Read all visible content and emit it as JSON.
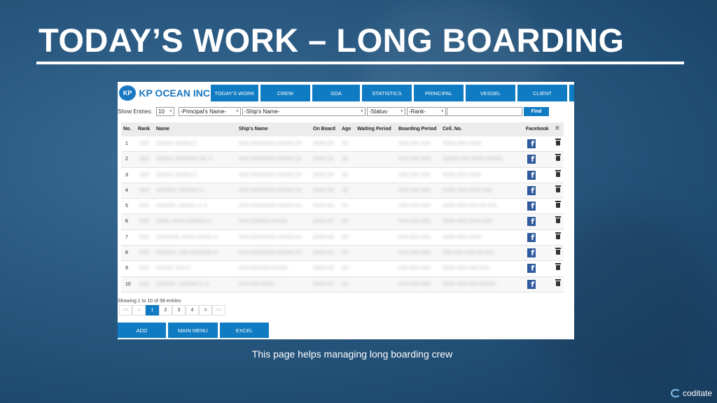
{
  "slide": {
    "title": "TODAY’S WORK – LONG BOARDING",
    "caption": "This page helps managing long boarding crew",
    "brand": "coditate"
  },
  "app": {
    "logo_badge": "KP",
    "logo_text": "KP OCEAN INC",
    "nav": [
      "TODAY'S WORK",
      "CREW",
      "SOA",
      "STATISTICS",
      "PRINCIPAL",
      "VESSEL",
      "CLIENT"
    ]
  },
  "filters": {
    "show_label": "Show Entries:",
    "show_value": "10",
    "principal": "-Principal's Name-",
    "ship": "-Ship's Name-",
    "status": "-Status-",
    "rank": "-Rank-",
    "search_value": "",
    "find_label": "Find"
  },
  "table": {
    "columns": [
      "No.",
      "Rank",
      "Name",
      "Ship's Name",
      "On Board",
      "Age",
      "Waiting Period",
      "Boarding Period",
      "Cell. No.",
      "Facebook"
    ],
    "facebook_glyph": "f",
    "rows": [
      {
        "no": "1",
        "rank": "XXX",
        "name": "XXXXX, XXXXX X.",
        "ship": "XXX XXXXXXXX XXXXX XX",
        "onboard": "XXXX.XX",
        "age": "XX",
        "boarding": "XXX XXX XXX",
        "cell": "XXXX XXX XXXX"
      },
      {
        "no": "2",
        "rank": "XXX",
        "name": "XXXXX, XXXXXXX XX. X.",
        "ship": "XXX XXXXXXXX XXXXX XX",
        "onboard": "XXXX.XX",
        "age": "XX",
        "boarding": "XXX XXX XXX",
        "cell": "XXXXX XXX XXXX XXXXX"
      },
      {
        "no": "3",
        "rank": "XXX",
        "name": "XXXXX, XXXXX X.",
        "ship": "XXX XXXXXXXX XXXXX XX",
        "onboard": "XXXX.XX",
        "age": "XX",
        "boarding": "XXX XXX XXX",
        "cell": "XXXX XXX XXXX"
      },
      {
        "no": "4",
        "rank": "XXX",
        "name": "XXXXXX, XXXXXX X.",
        "ship": "XXX XXXXXXXX XXXXX XX",
        "onboard": "XXXX.XX",
        "age": "XX",
        "boarding": "XXX XXX XXX",
        "cell": "XXXX XXX XXXX XXX"
      },
      {
        "no": "5",
        "rank": "XXX",
        "name": "XXXXXX, XXXXX, X. X.",
        "ship": "XXX XXXXXXXX XXXXX XX",
        "onboard": "XXXX.XX",
        "age": "XX",
        "boarding": "XXX XXX XXX",
        "cell": "XXXX XXX XXX XX XXX"
      },
      {
        "no": "6",
        "rank": "XXX",
        "name": "XXXX, XXXX XXXXXX X.",
        "ship": "XXX XXXXXX XXXXX",
        "onboard": "XXXX.XX",
        "age": "XX",
        "boarding": "XXX XXX XXX",
        "cell": "XXXX XXX XXXX XXX"
      },
      {
        "no": "7",
        "rank": "XXX",
        "name": "XXXXXXX, XXXX XXXXX X.",
        "ship": "XXX XXXXXXXX XXXXX XX",
        "onboard": "XXXX.XX",
        "age": "XX",
        "boarding": "XXX XXX XXX",
        "cell": "XXXX XXX XXXX"
      },
      {
        "no": "8",
        "rank": "XXX",
        "name": "XXXXXX, XXX XXXXXXX X.",
        "ship": "XXX XXXXXXXX XXXXX XX",
        "onboard": "XXXX.XX",
        "age": "XX",
        "boarding": "XXX XXX XXX",
        "cell": "XXX XXX XXX XX XXX"
      },
      {
        "no": "9",
        "rank": "XXX",
        "name": "XXXXX, XXX X.",
        "ship": "XXX XXXXXX XXXXX",
        "onboard": "XXXX.XX",
        "age": "XX",
        "boarding": "XXX XXX XXX",
        "cell": "XXXX XXX XXX XXX"
      },
      {
        "no": "10",
        "rank": "XXX",
        "name": "XXXXXX, XXXXXX X. X.",
        "ship": "XXX XXX XXXX",
        "onboard": "XXXX.XX",
        "age": "XX",
        "boarding": "XXX XXX XXX",
        "cell": "XXXX XXX XXX XXXXX"
      }
    ]
  },
  "footer": {
    "showing": "Showing 1 to 10 of 38 entries",
    "pager": [
      "<<",
      "<",
      "1",
      "2",
      "3",
      "4",
      ">",
      ">>"
    ],
    "buttons": [
      "ADD",
      "MAIN MENU",
      "EXCEL"
    ]
  }
}
